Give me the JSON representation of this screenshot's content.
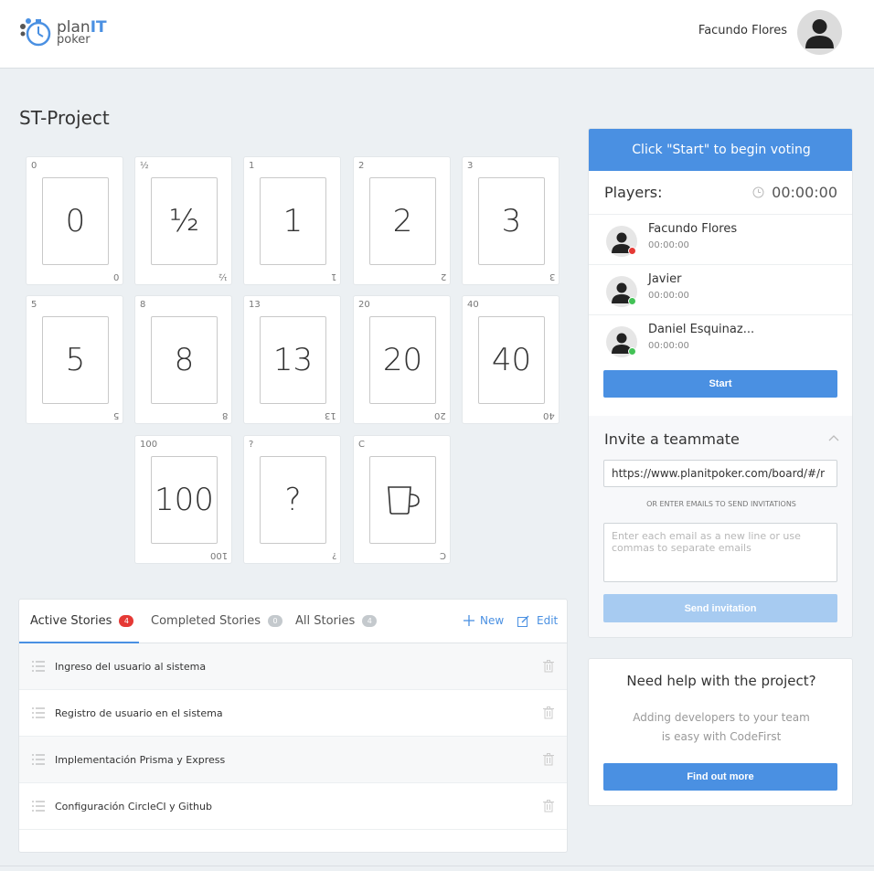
{
  "header": {
    "logo_plan": "plan",
    "logo_it": "IT",
    "logo_poker": "poker",
    "user_name": "Facundo Flores"
  },
  "project": {
    "title": "ST-Project"
  },
  "cards": [
    {
      "label": "0",
      "face": "0"
    },
    {
      "label": "½",
      "face": "½"
    },
    {
      "label": "1",
      "face": "1"
    },
    {
      "label": "2",
      "face": "2"
    },
    {
      "label": "3",
      "face": "3"
    },
    {
      "label": "5",
      "face": "5"
    },
    {
      "label": "8",
      "face": "8"
    },
    {
      "label": "13",
      "face": "13"
    },
    {
      "label": "20",
      "face": "20"
    },
    {
      "label": "40",
      "face": "40"
    },
    {
      "label": "100",
      "face": "100"
    },
    {
      "label": "?",
      "face": "?"
    },
    {
      "label": "C",
      "face": "coffee-cup-icon"
    }
  ],
  "stories": {
    "tabs": [
      {
        "label": "Active Stories",
        "count": "4"
      },
      {
        "label": "Completed Stories",
        "count": "0"
      },
      {
        "label": "All Stories",
        "count": "4"
      }
    ],
    "new_label": "New",
    "edit_label": "Edit",
    "items": [
      {
        "title": "Ingreso del usuario al sistema"
      },
      {
        "title": "Registro de usuario en el sistema"
      },
      {
        "title": "Implementación Prisma y Express"
      },
      {
        "title": "Configuración CircleCI y Github"
      }
    ]
  },
  "panel": {
    "header": "Click \"Start\" to begin voting",
    "players_label": "Players:",
    "timer": "00:00:00",
    "players": [
      {
        "name": "Facundo Flores",
        "time": "00:00:00",
        "status_color": "#e53935"
      },
      {
        "name": "Javier",
        "time": "00:00:00",
        "status_color": "#43c256"
      },
      {
        "name": "Daniel Esquinaz...",
        "time": "00:00:00",
        "status_color": "#43c256"
      }
    ],
    "start_label": "Start",
    "invite_title": "Invite a teammate",
    "invite_url": "https://www.planitpoker.com/board/#/r",
    "or_text": "OR ENTER EMAILS TO SEND INVITATIONS",
    "email_placeholder": "Enter each email as a new line or use commas to separate emails",
    "send_label": "Send invitation"
  },
  "help": {
    "title": "Need help with the project?",
    "line1": "Adding developers to your team",
    "line2": "is easy with CodeFirst",
    "button": "Find out more"
  },
  "colors": {
    "accent": "#4a90e2",
    "accent_light": "#a7cbf1",
    "danger": "#e53935",
    "online": "#43c256"
  }
}
